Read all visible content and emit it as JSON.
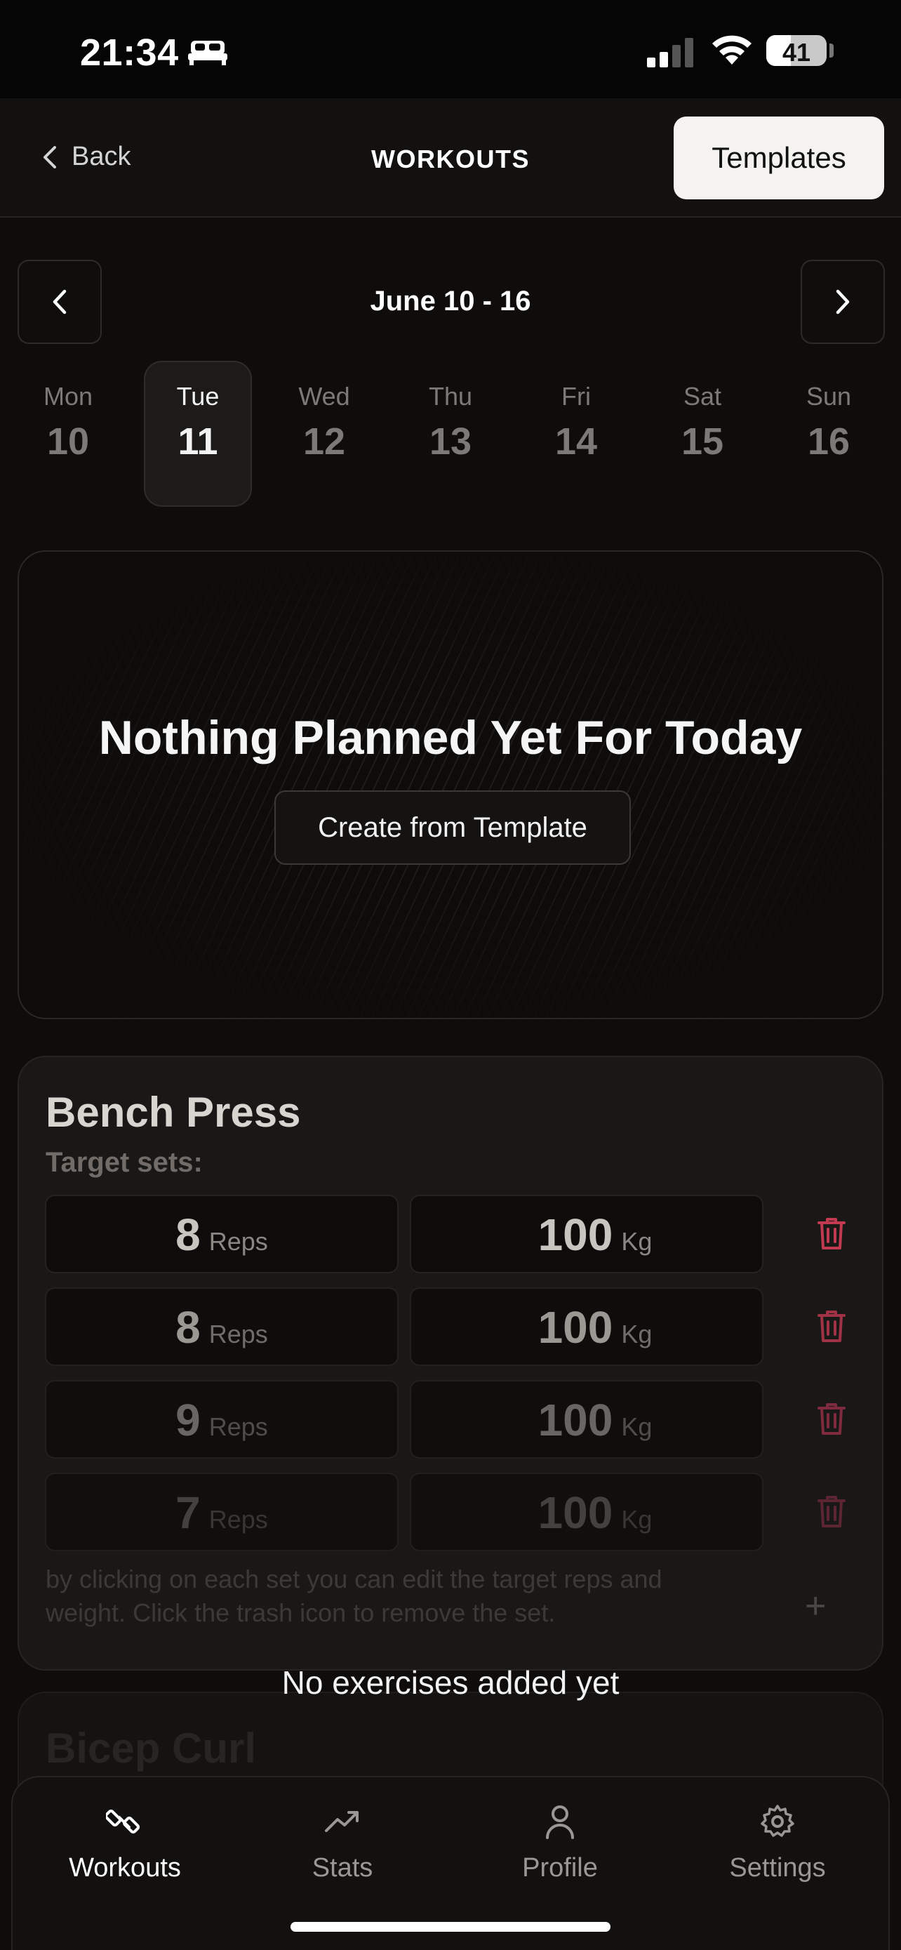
{
  "status_bar": {
    "time": "21:34",
    "battery": "41",
    "battery_level": 0.41
  },
  "header": {
    "back_label": "Back",
    "title": "WORKOUTS",
    "templates_label": "Templates"
  },
  "week": {
    "range": "June 10 - 16",
    "days": [
      {
        "name": "Mon",
        "num": "10"
      },
      {
        "name": "Tue",
        "num": "11",
        "selected": true
      },
      {
        "name": "Wed",
        "num": "12"
      },
      {
        "name": "Thu",
        "num": "13"
      },
      {
        "name": "Fri",
        "num": "14"
      },
      {
        "name": "Sat",
        "num": "15"
      },
      {
        "name": "Sun",
        "num": "16"
      }
    ]
  },
  "empty_state": {
    "title": "Nothing Planned Yet For Today",
    "button_label": "Create from Template"
  },
  "exercise": {
    "name": "Bench Press",
    "target_label": "Target sets:",
    "sets": [
      {
        "reps": "8",
        "reps_unit": "Reps",
        "weight": "100",
        "weight_unit": "Kg"
      },
      {
        "reps": "8",
        "reps_unit": "Reps",
        "weight": "100",
        "weight_unit": "Kg"
      },
      {
        "reps": "9",
        "reps_unit": "Reps",
        "weight": "100",
        "weight_unit": "Kg"
      },
      {
        "reps": "7",
        "reps_unit": "Reps",
        "weight": "100",
        "weight_unit": "Kg"
      }
    ],
    "help_text": "by clicking on each set you can edit the target reps and weight. Click the trash icon to remove the set.",
    "add_label": "+"
  },
  "no_exercises_text": "No exercises added yet",
  "next_exercise": {
    "name": "Bicep Curl"
  },
  "tabs": [
    {
      "label": "Workouts",
      "icon": "dumbbell-icon",
      "active": true
    },
    {
      "label": "Stats",
      "icon": "trending-up-icon"
    },
    {
      "label": "Profile",
      "icon": "person-icon"
    },
    {
      "label": "Settings",
      "icon": "gear-icon"
    }
  ],
  "colors": {
    "accent_danger": "#c0344a",
    "background": "#0e0d0c",
    "button_light": "#f4f3f0"
  }
}
